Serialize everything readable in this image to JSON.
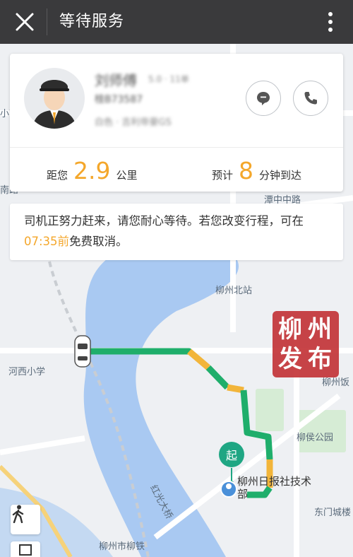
{
  "header": {
    "title": "等待服务"
  },
  "driver": {
    "name": "刘师傅",
    "rating": "5.0 · 11单",
    "plate": "桂B73587",
    "car": "白色 · 吉利帝豪GS"
  },
  "eta": {
    "distance_prefix": "距您",
    "distance_value": "2.9",
    "distance_unit": "公里",
    "time_prefix": "预计",
    "time_value": "8",
    "time_unit": "分钟到达"
  },
  "notice": {
    "part1": "司机正努力赶来，请您耐心等待。若您改变行程，可在",
    "time": "07:35前",
    "part2": "免费取消。"
  },
  "map": {
    "labels": {
      "liuzhou_north": "柳州北站",
      "hexi_school": "河西小学",
      "liuhou_park": "柳侯公园",
      "dongmen": "东门城楼",
      "liuzhou_fan": "柳州饭",
      "hongguang_bridge": "红光大桥",
      "railway": "柳州市柳铁",
      "xiaonan": "小南",
      "nan_lu": "南路",
      "rd_top": "潭中中路",
      "start": "起",
      "destination": "柳州日报社技术部"
    },
    "stamp": [
      "柳",
      "州",
      "发",
      "布"
    ]
  },
  "colors": {
    "accent": "#f4a72b",
    "route_green": "#1fae6b",
    "route_yellow": "#f2b53a",
    "start_marker": "#1fa683",
    "header_bg": "#3a3a3c"
  },
  "icons": [
    "close-icon",
    "more-icon",
    "message-icon",
    "phone-icon",
    "walk-icon",
    "locate-icon",
    "car-icon"
  ]
}
